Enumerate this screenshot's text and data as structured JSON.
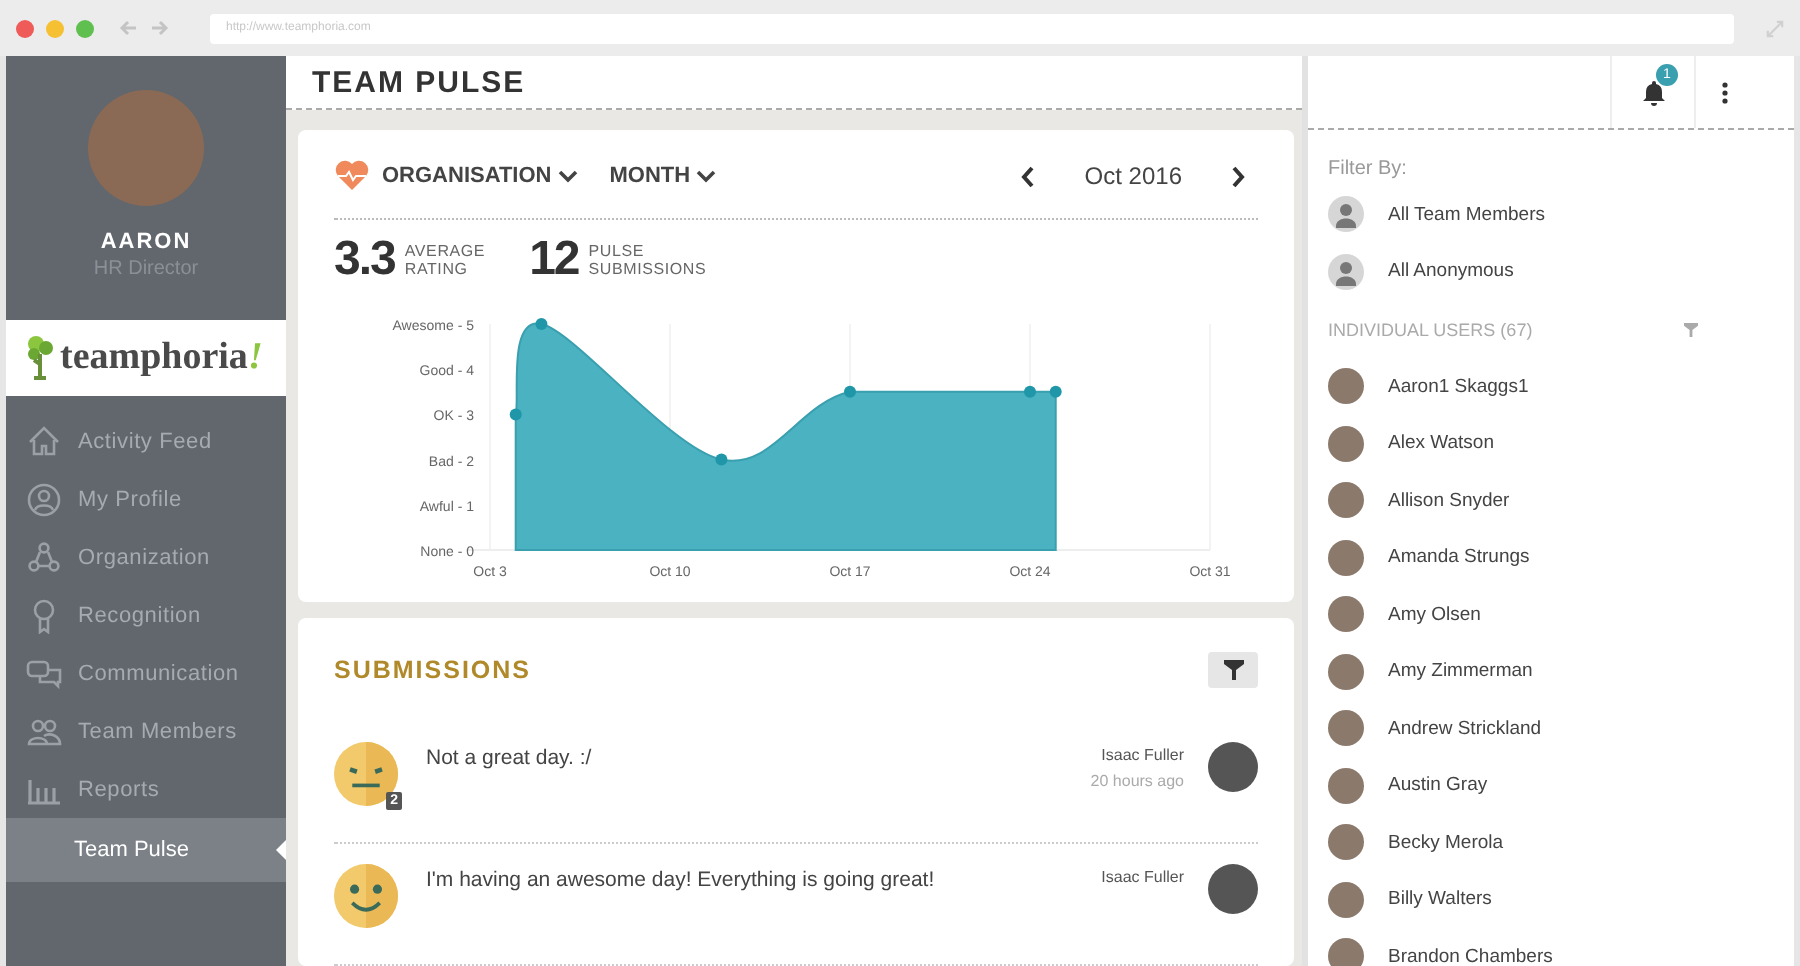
{
  "browser": {
    "address": "http://www.teamphoria.com"
  },
  "profile": {
    "name": "AARON",
    "role": "HR Director"
  },
  "logo": {
    "wordmark": "teamphoria",
    "accent": "!"
  },
  "sidebar": {
    "items": [
      {
        "label": "Activity Feed",
        "selected": false
      },
      {
        "label": "My Profile",
        "selected": false
      },
      {
        "label": "Organization",
        "selected": false
      },
      {
        "label": "Recognition",
        "selected": false
      },
      {
        "label": "Communication",
        "selected": false
      },
      {
        "label": "Team Members",
        "selected": false
      },
      {
        "label": "Reports",
        "selected": false,
        "children": [
          {
            "label": "Team Pulse",
            "selected": true
          }
        ]
      }
    ]
  },
  "header": {
    "title": "TEAM PULSE",
    "notifications": "1"
  },
  "pulse": {
    "scope": "ORGANISATION",
    "period": "MONTH",
    "date": "Oct 2016",
    "stats": [
      {
        "value": "3.3",
        "label_1": "AVERAGE",
        "label_2": "RATING"
      },
      {
        "value": "12",
        "label_1": "PULSE",
        "label_2": "SUBMISSIONS"
      }
    ],
    "chart": {
      "y_labels": [
        "Awesome - 5",
        "Good - 4",
        "OK - 3",
        "Bad - 2",
        "Awful - 1",
        "None - 0"
      ],
      "x_labels": [
        "Oct 3",
        "Oct 10",
        "Oct 17",
        "Oct 24",
        "Oct 31"
      ]
    }
  },
  "submissions": {
    "title": "SUBMISSIONS",
    "items": [
      {
        "kind": "neutral",
        "count": "2",
        "text": "Not a great day. :/",
        "author": "Isaac Fuller",
        "time": "20 hours ago"
      },
      {
        "kind": "happy",
        "text": "I'm having an awesome day! Everything is going great!",
        "author": "Isaac Fuller"
      }
    ]
  },
  "filter": {
    "title": "Filter By:",
    "options": [
      {
        "label": "All Team Members"
      },
      {
        "label": "All Anonymous"
      }
    ],
    "users_heading": "INDIVIDUAL USERS (67)",
    "users": [
      {
        "name": "Aaron1 Skaggs1"
      },
      {
        "name": "Alex Watson"
      },
      {
        "name": "Allison Snyder"
      },
      {
        "name": "Amanda Strungs"
      },
      {
        "name": "Amy Olsen"
      },
      {
        "name": "Amy Zimmerman"
      },
      {
        "name": "Andrew Strickland"
      },
      {
        "name": "Austin Gray"
      },
      {
        "name": "Becky Merola"
      },
      {
        "name": "Billy Walters"
      },
      {
        "name": "Brandon Chambers"
      }
    ]
  }
}
